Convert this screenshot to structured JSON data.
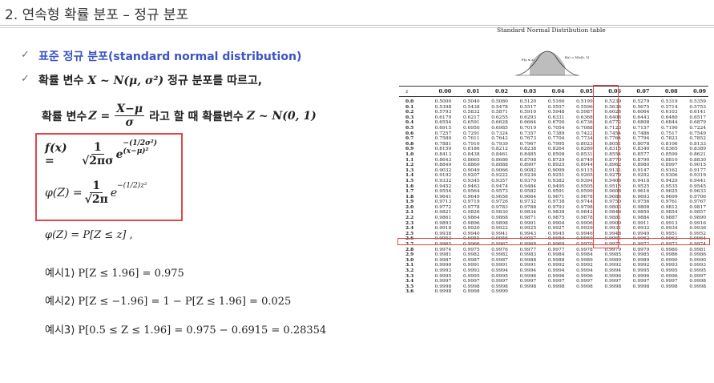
{
  "title": "2. 연속형 확률 분포 – 정규 분포",
  "bullets": {
    "b1": "표준 정규 분포(standard normal distribution)",
    "b2_prefix": "확률 변수 ",
    "b2_math": "X ~ N(μ, σ²)",
    "b2_suffix": " 정규 분포를 따르고,"
  },
  "line3": {
    "prefix": "확률 변수 ",
    "zvar": "Z =",
    "num": "X−μ",
    "den": "σ",
    "middle": " 라고 할 때  확률변수 ",
    "dist": "Z ~ N(0, 1)"
  },
  "formulas": {
    "f1_lhs": "f(x) =",
    "f1_num": "1",
    "f1_den": "√2πσ",
    "f1_e": "e",
    "f1_exp": "−(1/2σ²)(x−μ)²",
    "f2_lhs": "φ(Z) =",
    "f2_num": "1",
    "f2_den": "√2π",
    "f2_e": "e",
    "f2_exp": "−(1/2)z²"
  },
  "defn": "φ(Z) = P[Z ≤ z]  ,",
  "examples": [
    {
      "label": "예시1)",
      "expr": " P[Z ≤ 1.96] = 0.975"
    },
    {
      "label": "예시2)",
      "expr": " P[Z ≤ −1.96] = 1 − P[Z ≤ 1.96] = 0.025"
    },
    {
      "label": "예시3)",
      "expr": " P[0.5 ≤ Z ≤ 1.96] = 0.975  − 0.6915 = 0.28354"
    }
  ],
  "table": {
    "title": "Standard Normal Distribution table",
    "curve_label_left": "P(z ≤ z)",
    "curve_label_right": "f(z) = N(z|0, 1)",
    "headers": [
      "z",
      "0.00",
      "0.01",
      "0.02",
      "0.03",
      "0.04",
      "0.05",
      "0.06",
      "0.07",
      "0.08",
      "0.09"
    ],
    "rows": [
      [
        "0.0",
        "0.5000",
        "0.5040",
        "0.5080",
        "0.5120",
        "0.5160",
        "0.5199",
        "0.5239",
        "0.5279",
        "0.5319",
        "0.5359"
      ],
      [
        "0.1",
        "0.5398",
        "0.5438",
        "0.5478",
        "0.5517",
        "0.5557",
        "0.5596",
        "0.5636",
        "0.5675",
        "0.5714",
        "0.5753"
      ],
      [
        "0.2",
        "0.5793",
        "0.5832",
        "0.5871",
        "0.5910",
        "0.5948",
        "0.5987",
        "0.6026",
        "0.6064",
        "0.6103",
        "0.6141"
      ],
      [
        "0.3",
        "0.6179",
        "0.6217",
        "0.6255",
        "0.6293",
        "0.6331",
        "0.6368",
        "0.6406",
        "0.6443",
        "0.6480",
        "0.6517"
      ],
      [
        "0.4",
        "0.6554",
        "0.6591",
        "0.6628",
        "0.6664",
        "0.6700",
        "0.6736",
        "0.6772",
        "0.6808",
        "0.6844",
        "0.6879"
      ],
      [
        "0.5",
        "0.6915",
        "0.6950",
        "0.6985",
        "0.7019",
        "0.7054",
        "0.7088",
        "0.7123",
        "0.7157",
        "0.7190",
        "0.7224"
      ],
      [
        "0.6",
        "0.7257",
        "0.7291",
        "0.7324",
        "0.7357",
        "0.7389",
        "0.7422",
        "0.7454",
        "0.7486",
        "0.7517",
        "0.7549"
      ],
      [
        "0.7",
        "0.7580",
        "0.7611",
        "0.7642",
        "0.7673",
        "0.7704",
        "0.7734",
        "0.7764",
        "0.7794",
        "0.7823",
        "0.7852"
      ],
      [
        "0.8",
        "0.7881",
        "0.7910",
        "0.7939",
        "0.7967",
        "0.7995",
        "0.8023",
        "0.8051",
        "0.8078",
        "0.8106",
        "0.8133"
      ],
      [
        "0.9",
        "0.8159",
        "0.8186",
        "0.8212",
        "0.8238",
        "0.8264",
        "0.8289",
        "0.8315",
        "0.8340",
        "0.8365",
        "0.8389"
      ],
      [
        "1.0",
        "0.8413",
        "0.8438",
        "0.8461",
        "0.8485",
        "0.8508",
        "0.8531",
        "0.8554",
        "0.8577",
        "0.8599",
        "0.8621"
      ],
      [
        "1.1",
        "0.8643",
        "0.8665",
        "0.8686",
        "0.8708",
        "0.8729",
        "0.8749",
        "0.8770",
        "0.8790",
        "0.8810",
        "0.8830"
      ],
      [
        "1.2",
        "0.8849",
        "0.8869",
        "0.8888",
        "0.8907",
        "0.8925",
        "0.8944",
        "0.8962",
        "0.8980",
        "0.8997",
        "0.9015"
      ],
      [
        "1.3",
        "0.9032",
        "0.9049",
        "0.9066",
        "0.9082",
        "0.9099",
        "0.9115",
        "0.9131",
        "0.9147",
        "0.9162",
        "0.9177"
      ],
      [
        "1.4",
        "0.9192",
        "0.9207",
        "0.9222",
        "0.9236",
        "0.9251",
        "0.9265",
        "0.9279",
        "0.9292",
        "0.9306",
        "0.9319"
      ],
      [
        "1.5",
        "0.9332",
        "0.9345",
        "0.9357",
        "0.9370",
        "0.9382",
        "0.9394",
        "0.9406",
        "0.9418",
        "0.9429",
        "0.9441"
      ],
      [
        "1.6",
        "0.9452",
        "0.9463",
        "0.9474",
        "0.9484",
        "0.9495",
        "0.9505",
        "0.9515",
        "0.9525",
        "0.9535",
        "0.9545"
      ],
      [
        "1.7",
        "0.9554",
        "0.9564",
        "0.9573",
        "0.9582",
        "0.9591",
        "0.9599",
        "0.9608",
        "0.9616",
        "0.9625",
        "0.9633"
      ],
      [
        "1.8",
        "0.9641",
        "0.9649",
        "0.9656",
        "0.9664",
        "0.9671",
        "0.9678",
        "0.9686",
        "0.9693",
        "0.9699",
        "0.9706"
      ],
      [
        "1.9",
        "0.9713",
        "0.9719",
        "0.9726",
        "0.9732",
        "0.9738",
        "0.9744",
        "0.9750",
        "0.9756",
        "0.9761",
        "0.9767"
      ],
      [
        "2.0",
        "0.9772",
        "0.9778",
        "0.9783",
        "0.9788",
        "0.9793",
        "0.9798",
        "0.9803",
        "0.9808",
        "0.9812",
        "0.9817"
      ],
      [
        "2.1",
        "0.9821",
        "0.9826",
        "0.9830",
        "0.9834",
        "0.9838",
        "0.9842",
        "0.9846",
        "0.9850",
        "0.9854",
        "0.9857"
      ],
      [
        "2.2",
        "0.9861",
        "0.9864",
        "0.9868",
        "0.9871",
        "0.9875",
        "0.9878",
        "0.9881",
        "0.9884",
        "0.9887",
        "0.9890"
      ],
      [
        "2.3",
        "0.9893",
        "0.9896",
        "0.9898",
        "0.9901",
        "0.9904",
        "0.9906",
        "0.9909",
        "0.9911",
        "0.9913",
        "0.9916"
      ],
      [
        "2.4",
        "0.9918",
        "0.9920",
        "0.9922",
        "0.9925",
        "0.9927",
        "0.9929",
        "0.9931",
        "0.9932",
        "0.9934",
        "0.9936"
      ],
      [
        "2.5",
        "0.9938",
        "0.9940",
        "0.9941",
        "0.9943",
        "0.9945",
        "0.9946",
        "0.9948",
        "0.9949",
        "0.9951",
        "0.9952"
      ],
      [
        "2.6",
        "0.9953",
        "0.9955",
        "0.9956",
        "0.9957",
        "0.9959",
        "0.9960",
        "0.9961",
        "0.9962",
        "0.9963",
        "0.9964"
      ],
      [
        "2.7",
        "0.9965",
        "0.9966",
        "0.9967",
        "0.9968",
        "0.9969",
        "0.9970",
        "0.9971",
        "0.9972",
        "0.9973",
        "0.9974"
      ],
      [
        "2.8",
        "0.9974",
        "0.9975",
        "0.9976",
        "0.9977",
        "0.9977",
        "0.9978",
        "0.9979",
        "0.9979",
        "0.9980",
        "0.9981"
      ],
      [
        "2.9",
        "0.9981",
        "0.9982",
        "0.9982",
        "0.9983",
        "0.9984",
        "0.9984",
        "0.9985",
        "0.9985",
        "0.9986",
        "0.9986"
      ],
      [
        "3.0",
        "0.9987",
        "0.9987",
        "0.9987",
        "0.9988",
        "0.9988",
        "0.9989",
        "0.9989",
        "0.9989",
        "0.9990",
        "0.9990"
      ],
      [
        "3.1",
        "0.9990",
        "0.9991",
        "0.9991",
        "0.9991",
        "0.9992",
        "0.9992",
        "0.9992",
        "0.9992",
        "0.9993",
        "0.9993"
      ],
      [
        "3.2",
        "0.9993",
        "0.9993",
        "0.9994",
        "0.9994",
        "0.9994",
        "0.9994",
        "0.9994",
        "0.9995",
        "0.9995",
        "0.9995"
      ],
      [
        "3.3",
        "0.9995",
        "0.9995",
        "0.9995",
        "0.9996",
        "0.9996",
        "0.9996",
        "0.9996",
        "0.9996",
        "0.9996",
        "0.9997"
      ],
      [
        "3.4",
        "0.9997",
        "0.9997",
        "0.9997",
        "0.9997",
        "0.9997",
        "0.9997",
        "0.9997",
        "0.9997",
        "0.9997",
        "0.9998"
      ],
      [
        "3.5",
        "0.9998",
        "0.9998",
        "0.9998",
        "0.9998",
        "0.9998",
        "0.9998",
        "0.9998",
        "0.9998",
        "0.9998",
        "0.9998"
      ],
      [
        "3.6",
        "0.9998",
        "0.9998",
        "0.9999"
      ]
    ]
  },
  "colors": {
    "accent_blue": "#3b55c4",
    "highlight_red": "#e04848"
  }
}
